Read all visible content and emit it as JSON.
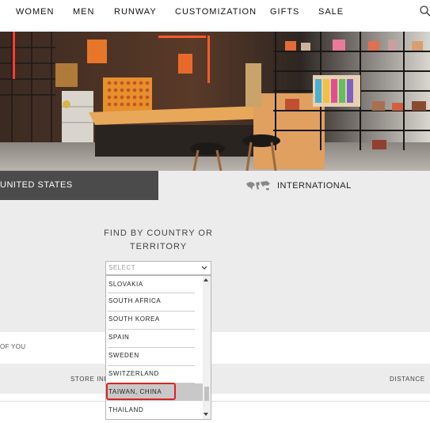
{
  "nav": {
    "items": [
      "WOMEN",
      "MEN",
      "RUNWAY",
      "CUSTOMIZATION",
      "GIFTS",
      "SALE"
    ]
  },
  "tabs": {
    "us_label": "UNITED STATES",
    "intl_label": "INTERNATIONAL"
  },
  "finder": {
    "heading": "FIND BY COUNTRY OR TERRITORY",
    "select_placeholder": "SELECT",
    "options": [
      "SLOVAKIA",
      "SOUTH AFRICA",
      "SOUTH KOREA",
      "SPAIN",
      "SWEDEN",
      "SWITZERLAND",
      "TAIWAN, CHINA",
      "THAILAND"
    ],
    "highlighted_option": "TAIWAN, CHINA"
  },
  "results": {
    "near_text": "OF YOU",
    "store_header": "STORE INF",
    "distance_header": "DISTANCE"
  },
  "colors": {
    "us_tab_bg": "#4b4b4b",
    "panel_bg": "#ececec",
    "highlight_bg": "#c8c8c8",
    "annotation_red": "#e02020"
  }
}
